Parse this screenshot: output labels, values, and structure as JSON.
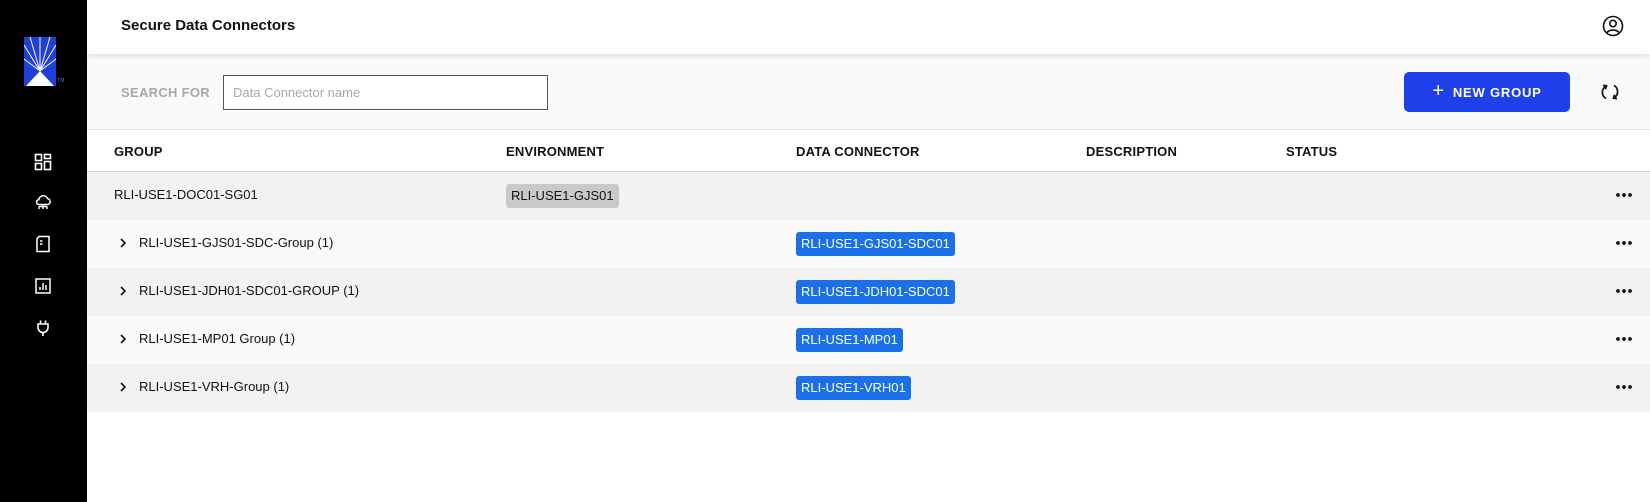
{
  "app": {
    "title": "Secure Data Connectors"
  },
  "logo": {
    "tm": "TM"
  },
  "sidebar": {
    "items": [
      {
        "icon": "dashboard-icon"
      },
      {
        "icon": "cloud-network-icon"
      },
      {
        "icon": "document-icon"
      },
      {
        "icon": "report-chart-icon"
      },
      {
        "icon": "plug-icon"
      }
    ]
  },
  "toolbar": {
    "search_label": "SEARCH FOR",
    "search_placeholder": "Data Connector name",
    "search_value": "",
    "new_group_label": "NEW GROUP"
  },
  "table": {
    "headers": {
      "group": "GROUP",
      "environment": "ENVIRONMENT",
      "data_connector": "DATA CONNECTOR",
      "description": "DESCRIPTION",
      "status": "STATUS"
    },
    "parent_row": {
      "group": "RLI-USE1-DOC01-SG01",
      "environment": "RLI-USE1-GJS01"
    },
    "child_rows": [
      {
        "group": "RLI-USE1-GJS01-SDC-Group (1)",
        "connector": "RLI-USE1-GJS01-SDC01"
      },
      {
        "group": "RLI-USE1-JDH01-SDC01-GROUP (1)",
        "connector": "RLI-USE1-JDH01-SDC01"
      },
      {
        "group": "RLI-USE1-MP01 Group (1)",
        "connector": "RLI-USE1-MP01"
      },
      {
        "group": "RLI-USE1-VRH-Group (1)",
        "connector": "RLI-USE1-VRH01"
      }
    ]
  },
  "colors": {
    "sidebar": "#000000",
    "accent": "#1f3fe8",
    "connector_tag": "#1a70e6",
    "environment_tag": "#c9c9c9"
  }
}
